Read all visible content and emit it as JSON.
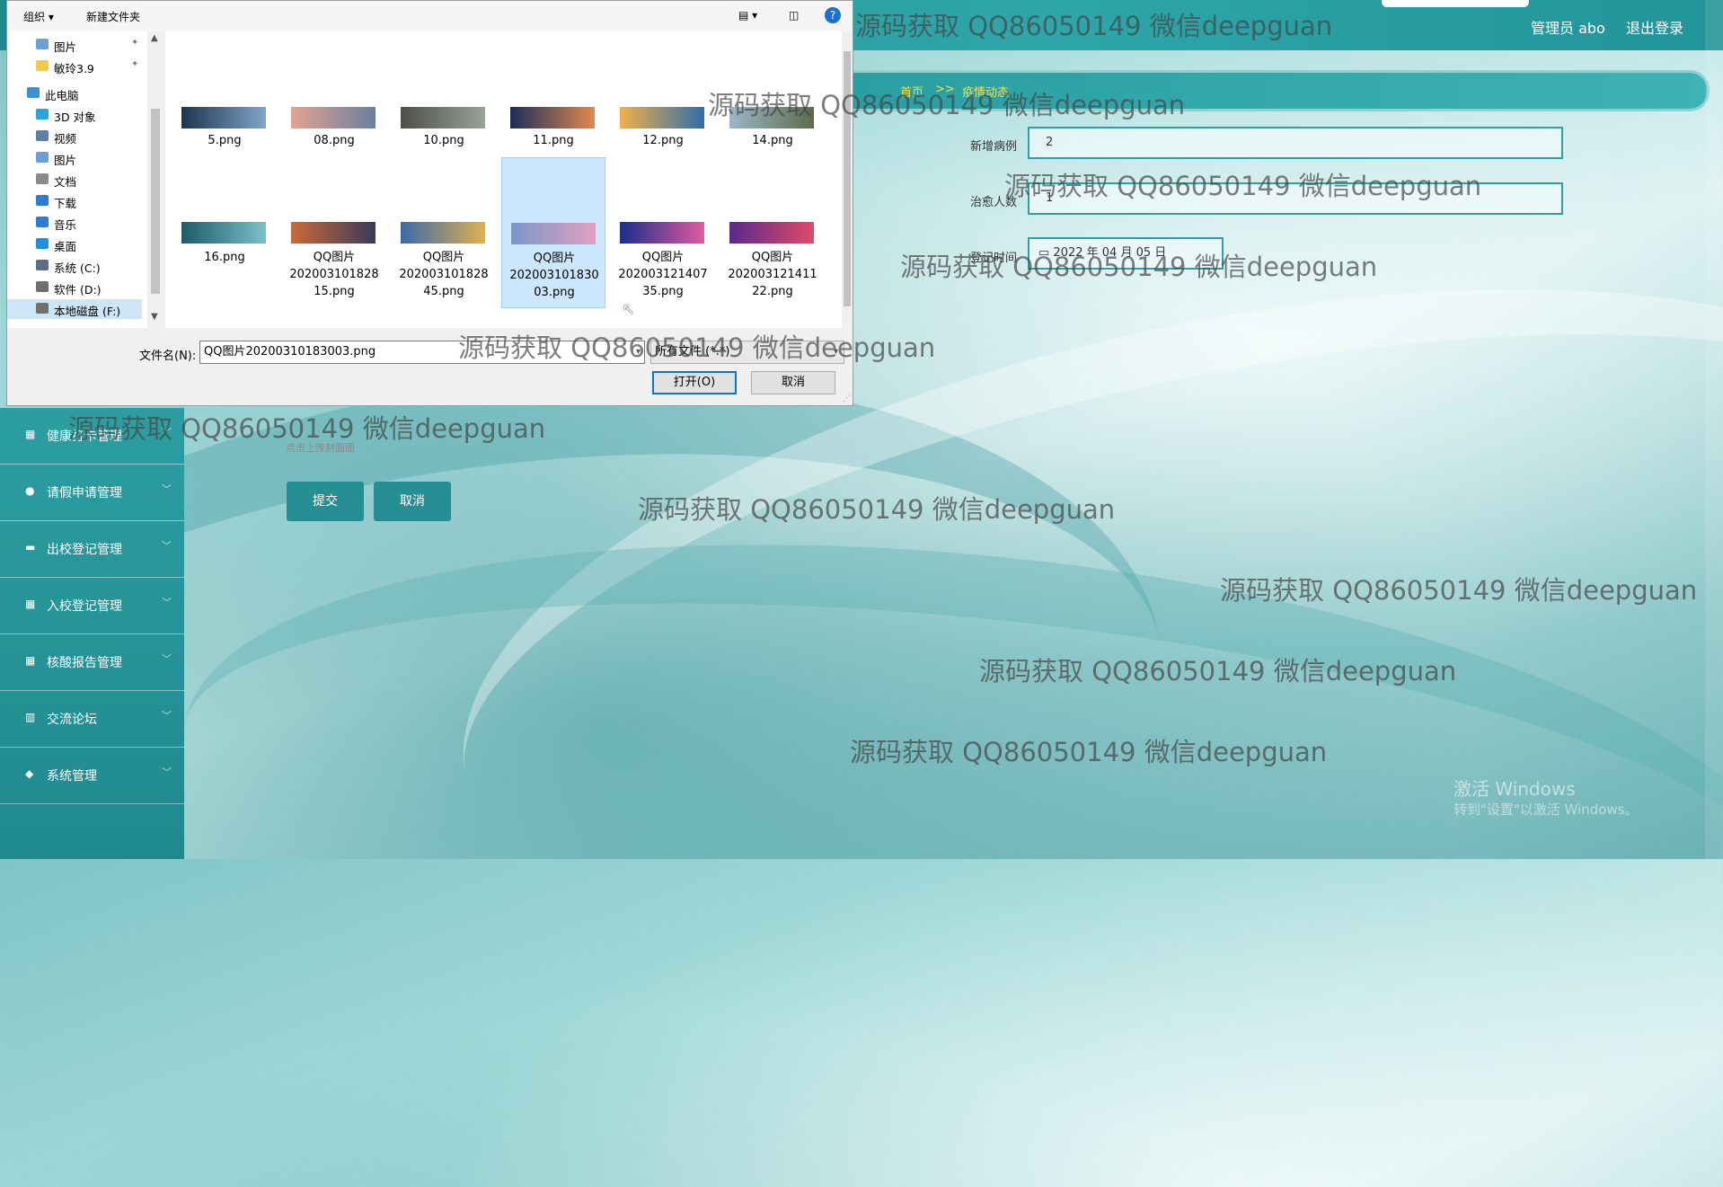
{
  "header": {
    "user_label": "管理员 abo",
    "logout_label": "退出登录"
  },
  "breadcrumb": {
    "home": "首页",
    "sep": ">>",
    "current": "疫情动态"
  },
  "form": {
    "fields": [
      {
        "label": "新增病例",
        "value": "2"
      },
      {
        "label": "治愈人数",
        "value": "1"
      },
      {
        "label": "登记时间",
        "value": "2022 年 04 月 05 日"
      }
    ],
    "upload_hint": "点击上传封面图",
    "submit_label": "提交",
    "cancel_label": "取消"
  },
  "sidebar": {
    "items": [
      {
        "label": "健康打卡管理",
        "icon": "grid-icon"
      },
      {
        "label": "请假申请管理",
        "icon": "person-icon"
      },
      {
        "label": "出校登记管理",
        "icon": "chat-icon"
      },
      {
        "label": "入校登记管理",
        "icon": "grid-icon"
      },
      {
        "label": "核酸报告管理",
        "icon": "grid-icon"
      },
      {
        "label": "交流论坛",
        "icon": "chart-icon"
      },
      {
        "label": "系统管理",
        "icon": "pin-icon"
      }
    ]
  },
  "dialog": {
    "toolbar": {
      "organize": "组织 ▾",
      "new_folder": "新建文件夹"
    },
    "nav": [
      {
        "label": "图片",
        "icon_color": "#6aa0d8",
        "pinned": true
      },
      {
        "label": "敏玲3.9",
        "icon_color": "#f2c94c",
        "pinned": true
      },
      {
        "label": "此电脑",
        "icon_color": "#3a8fd6",
        "pinned": false
      },
      {
        "label": "3D 对象",
        "icon_color": "#2aa3d8",
        "pinned": false
      },
      {
        "label": "视频",
        "icon_color": "#5c7fa8",
        "pinned": false
      },
      {
        "label": "图片",
        "icon_color": "#6aa0d8",
        "pinned": false
      },
      {
        "label": "文档",
        "icon_color": "#8a8a8a",
        "pinned": false
      },
      {
        "label": "下载",
        "icon_color": "#2b7cd3",
        "pinned": false
      },
      {
        "label": "音乐",
        "icon_color": "#2b7cd3",
        "pinned": false
      },
      {
        "label": "桌面",
        "icon_color": "#1e90e0",
        "pinned": false
      },
      {
        "label": "系统 (C:)",
        "icon_color": "#5a6f85",
        "pinned": false
      },
      {
        "label": "软件 (D:)",
        "icon_color": "#707070",
        "pinned": false
      },
      {
        "label": "本地磁盘 (F:)",
        "icon_color": "#707070",
        "pinned": false,
        "selected": true
      }
    ],
    "files_row1": [
      {
        "name": "5.png",
        "colors": [
          "#1e3550",
          "#7fa6c8"
        ]
      },
      {
        "name": "08.png",
        "colors": [
          "#e3a38f",
          "#6b7fa0"
        ]
      },
      {
        "name": "10.png",
        "colors": [
          "#4e4e4a",
          "#9aa29a"
        ]
      },
      {
        "name": "11.png",
        "colors": [
          "#1b2c5a",
          "#e08a4c"
        ]
      },
      {
        "name": "12.png",
        "colors": [
          "#f0b04c",
          "#2f6ea8"
        ]
      },
      {
        "name": "14.png",
        "colors": [
          "#9bb7c9",
          "#5d6b4a"
        ]
      }
    ],
    "files_row2": [
      {
        "name_lines": [
          "16.png"
        ],
        "colors": [
          "#1e5a6a",
          "#7bc0c8"
        ]
      },
      {
        "name_lines": [
          "QQ图片",
          "202003101828",
          "15.png"
        ],
        "colors": [
          "#c86b3a",
          "#3a3a58"
        ]
      },
      {
        "name_lines": [
          "QQ图片",
          "202003101828",
          "45.png"
        ],
        "colors": [
          "#3a6aa8",
          "#e0b050"
        ]
      },
      {
        "name_lines": [
          "QQ图片",
          "202003101830",
          "03.png"
        ],
        "colors": [
          "#7a98c8",
          "#e0a0c0"
        ],
        "selected": true
      },
      {
        "name_lines": [
          "QQ图片",
          "202003121407",
          "35.png"
        ],
        "colors": [
          "#1a2e8a",
          "#e05aa0"
        ]
      },
      {
        "name_lines": [
          "QQ图片",
          "202003121411",
          "22.png"
        ],
        "colors": [
          "#5a2a8a",
          "#e04a6a"
        ]
      }
    ],
    "filename_label": "文件名(N):",
    "filename_value": "QQ图片20200310183003.png",
    "filter_value": "所有文件 (*.*)",
    "open_label": "打开(O)",
    "cancel_label": "取消"
  },
  "watermark_text": "源码获取 QQ86050149 微信deepguan",
  "activate": {
    "line1": "激活 Windows",
    "line2": "转到\"设置\"以激活 Windows。"
  }
}
